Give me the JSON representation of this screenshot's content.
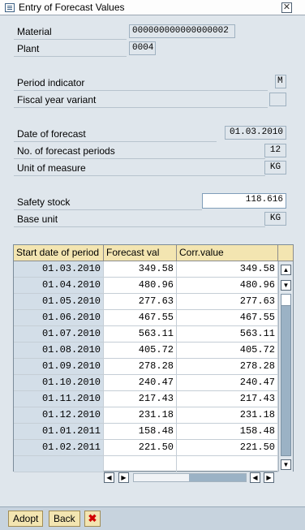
{
  "window": {
    "title": "Entry of Forecast Values",
    "title_icon": "document-icon",
    "close_glyph": "✕"
  },
  "fields": {
    "material": {
      "label": "Material",
      "value": "000000000000000002"
    },
    "plant": {
      "label": "Plant",
      "value": "0004"
    },
    "period_indicator": {
      "label": "Period indicator",
      "value": "M"
    },
    "fiscal_year_variant": {
      "label": "Fiscal year variant",
      "value": ""
    },
    "date_of_forecast": {
      "label": "Date of forecast",
      "value": "01.03.2010"
    },
    "num_forecast_periods": {
      "label": "No. of forecast periods",
      "value": "12"
    },
    "unit_of_measure": {
      "label": "Unit of measure",
      "value": "KG"
    },
    "safety_stock": {
      "label": "Safety stock",
      "value": "118.616"
    },
    "base_unit": {
      "label": "Base unit",
      "value": "KG"
    }
  },
  "table": {
    "headers": [
      "Start date of period",
      "Forecast val",
      "Corr.value"
    ],
    "rows": [
      [
        "01.03.2010",
        "349.58",
        "349.58"
      ],
      [
        "01.04.2010",
        "480.96",
        "480.96"
      ],
      [
        "01.05.2010",
        "277.63",
        "277.63"
      ],
      [
        "01.06.2010",
        "467.55",
        "467.55"
      ],
      [
        "01.07.2010",
        "563.11",
        "563.11"
      ],
      [
        "01.08.2010",
        "405.72",
        "405.72"
      ],
      [
        "01.09.2010",
        "278.28",
        "278.28"
      ],
      [
        "01.10.2010",
        "240.47",
        "240.47"
      ],
      [
        "01.11.2010",
        "217.43",
        "217.43"
      ],
      [
        "01.12.2010",
        "231.18",
        "231.18"
      ],
      [
        "01.01.2011",
        "158.48",
        "158.48"
      ],
      [
        "01.02.2011",
        "221.50",
        "221.50"
      ]
    ]
  },
  "buttons": {
    "adopt": "Adopt",
    "back": "Back",
    "cancel_glyph": "✖"
  },
  "colors": {
    "header_bg": "#f3e5b1",
    "key_column_bg": "#d3dee8",
    "body_bg": "#dfe6ec"
  }
}
